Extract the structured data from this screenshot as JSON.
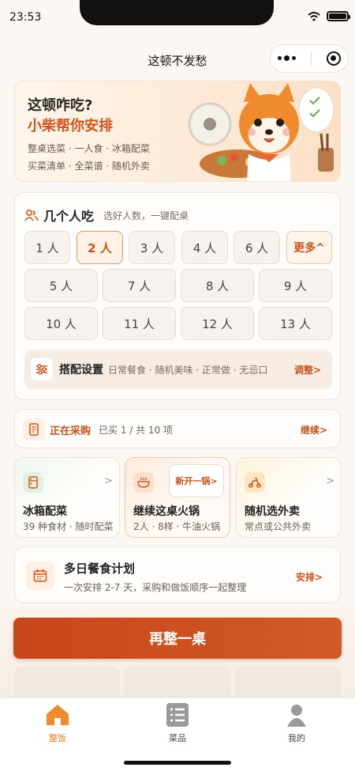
{
  "status": {
    "time": "23:53"
  },
  "nav": {
    "title": "这顿不发愁"
  },
  "hero": {
    "title": "这顿咋吃?",
    "subtitle": "小柴帮你安排",
    "line1": "整桌选菜 · 一人食 · 冰箱配菜",
    "line2": "买菜清单 · 全菜谱 · 随机外卖"
  },
  "people": {
    "title": "几个人吃",
    "hint": "选好人数，一键配桌",
    "row1": [
      "1 人",
      "2 人",
      "3 人",
      "4 人",
      "6 人"
    ],
    "more": "更多^",
    "row2": [
      "5 人",
      "7 人",
      "8 人",
      "9 人"
    ],
    "row3": [
      "10 人",
      "11 人",
      "12 人",
      "13 人"
    ],
    "selected": "2 人"
  },
  "setting": {
    "title": "搭配设置",
    "desc": "日常餐食 · 随机美味 · 正常做 · 无忌口",
    "action": "调整>"
  },
  "buying": {
    "title": "正在采购",
    "progress": "已买 1 / 共 10 项",
    "action": "继续>"
  },
  "minis": [
    {
      "title": "冰箱配菜",
      "desc": "39 种食材 · 随时配菜",
      "arrow": ">"
    },
    {
      "title": "继续这桌火锅",
      "desc": "2人 · 8样 · 牛油火锅",
      "badge": "新开一锅>"
    },
    {
      "title": "随机选外卖",
      "desc": "常点或公共外卖",
      "arrow": ">"
    }
  ],
  "plan": {
    "title": "多日餐食计划",
    "desc": "一次安排 2-7 天，采购和做饭顺序一起整理",
    "action": "安排>"
  },
  "cta": {
    "label": "再整一桌"
  },
  "tabs": [
    {
      "label": "整饭",
      "active": true
    },
    {
      "label": "菜品",
      "active": false
    },
    {
      "label": "我的",
      "active": false
    }
  ],
  "colors": {
    "accent": "#c8511c",
    "cta": "#c8461a",
    "tab_active": "#e87a2a"
  }
}
